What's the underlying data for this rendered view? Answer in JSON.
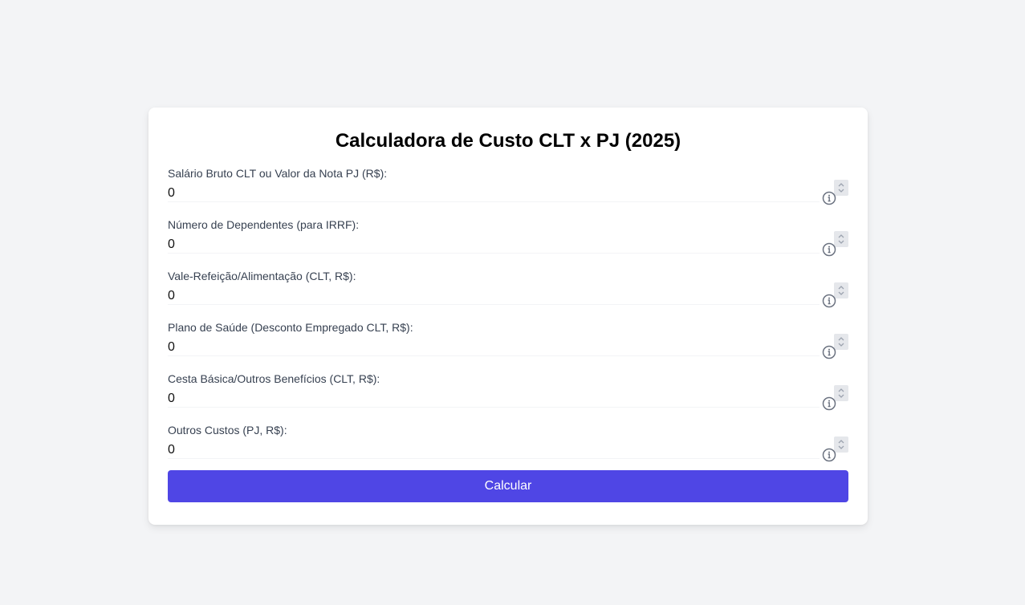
{
  "title": "Calculadora de Custo CLT x PJ (2025)",
  "fields": [
    {
      "label": "Salário Bruto CLT ou Valor da Nota PJ (R$):",
      "value": "0"
    },
    {
      "label": "Número de Dependentes (para IRRF):",
      "value": "0"
    },
    {
      "label": "Vale-Refeição/Alimentação (CLT, R$):",
      "value": "0"
    },
    {
      "label": "Plano de Saúde (Desconto Empregado CLT, R$):",
      "value": "0"
    },
    {
      "label": "Cesta Básica/Outros Benefícios (CLT, R$):",
      "value": "0"
    },
    {
      "label": "Outros Custos (PJ, R$):",
      "value": "0"
    }
  ],
  "button_label": "Calcular",
  "colors": {
    "background": "#f3f4f6",
    "card": "#ffffff",
    "accent": "#4f46e5",
    "label": "#374151",
    "icon": "#6b7280"
  },
  "icons": {
    "info": "info-circle-icon",
    "spinner": "number-spinner-icon"
  }
}
